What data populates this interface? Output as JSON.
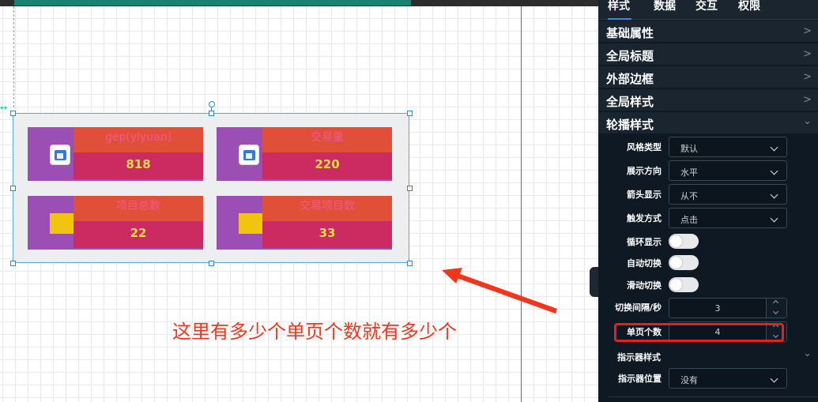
{
  "canvas": {
    "cards": [
      {
        "title": "gep(ylyuan)",
        "value": "818",
        "icon": "calendar-icon"
      },
      {
        "title": "交易量",
        "value": "220",
        "icon": "calendar-icon"
      },
      {
        "title": "项目总数",
        "value": "22",
        "icon": "yellow-square-icon"
      },
      {
        "title": "交易项目数",
        "value": "33",
        "icon": "yellow-square-icon"
      }
    ],
    "annotation": "这里有多少个单页个数就有多少个",
    "colors": {
      "card_bg": "#9b4fb4",
      "card_title_bg": "#e05038",
      "card_value_bg": "#cc2b62",
      "value_text": "#f5dd43",
      "annotation": "#f2361e"
    }
  },
  "panel": {
    "tabs": [
      "样式",
      "数据",
      "交互",
      "权限"
    ],
    "active_tab": "样式",
    "sections": [
      {
        "label": "基础属性",
        "expanded": false
      },
      {
        "label": "全局标题",
        "expanded": false
      },
      {
        "label": "外部边框",
        "expanded": false
      },
      {
        "label": "全局样式",
        "expanded": false
      },
      {
        "label": "轮播样式",
        "expanded": true
      }
    ],
    "carousel": {
      "style_type": {
        "label": "风格类型",
        "value": "默认"
      },
      "direction": {
        "label": "展示方向",
        "value": "水平"
      },
      "arrow": {
        "label": "箭头显示",
        "value": "从不"
      },
      "trigger": {
        "label": "触发方式",
        "value": "点击"
      },
      "loop": {
        "label": "循环显示",
        "on": false
      },
      "autoplay": {
        "label": "自动切换",
        "on": false
      },
      "swipe": {
        "label": "滑动切换",
        "on": false
      },
      "interval": {
        "label": "切换间隔/秒",
        "value": "3"
      },
      "page_count": {
        "label": "单页个数",
        "value": "4"
      }
    },
    "indicator": {
      "section_label": "指示器样式",
      "position": {
        "label": "指示器位置",
        "value": "没有"
      }
    },
    "accent": "#2d8cf0"
  }
}
